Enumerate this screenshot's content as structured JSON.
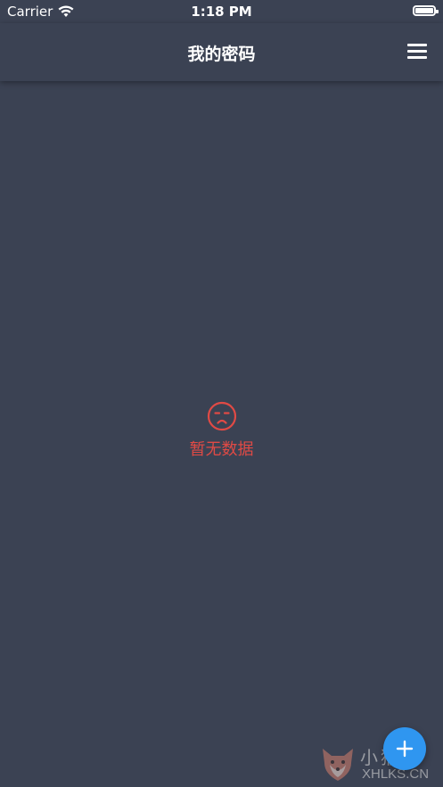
{
  "status_bar": {
    "carrier": "Carrier",
    "time": "1:18 PM",
    "icons": [
      "wifi-icon",
      "battery-icon"
    ]
  },
  "nav_bar": {
    "title": "我的密码",
    "menu_icon": "menu-icon"
  },
  "empty_state": {
    "icon": "sad-face-icon",
    "text": "暂无数据",
    "color": "#e04a45"
  },
  "fab": {
    "icon": "plus-icon",
    "color": "#2f96f0"
  },
  "watermark": {
    "cn": "小猴网",
    "en": "XHLKS.CN"
  },
  "colors": {
    "background": "#3b4253",
    "text": "#ffffff"
  }
}
